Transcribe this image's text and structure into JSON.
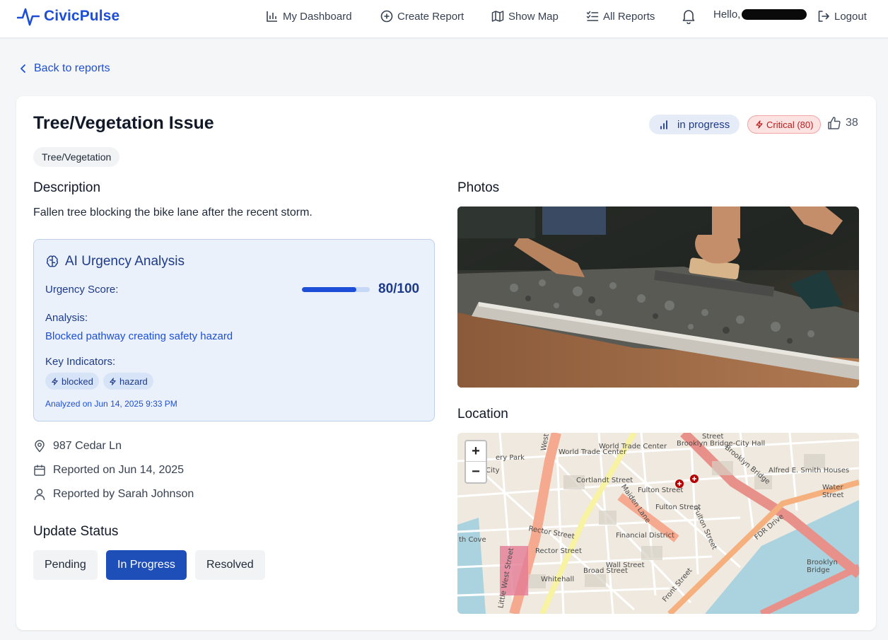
{
  "navbar": {
    "brand": "CivicPulse",
    "items": [
      {
        "label": "My Dashboard",
        "icon": "bar-chart-icon"
      },
      {
        "label": "Create Report",
        "icon": "plus-circle-icon"
      },
      {
        "label": "Show Map",
        "icon": "map-icon"
      },
      {
        "label": "All Reports",
        "icon": "list-check-icon"
      }
    ],
    "greeting": "Hello,",
    "logout": "Logout"
  },
  "back_link": "Back to reports",
  "report": {
    "title": "Tree/Vegetation Issue",
    "category": "Tree/Vegetation",
    "status": "in progress",
    "severity": "Critical (80)",
    "likes": "38",
    "description_heading": "Description",
    "description": "Fallen tree blocking the bike lane after the recent storm.",
    "photos_heading": "Photos",
    "location_heading": "Location",
    "address": "987 Cedar Ln",
    "reported_on": "Reported on Jun 14, 2025",
    "reported_by": "Reported by Sarah Johnson"
  },
  "ai_analysis": {
    "heading": "AI Urgency Analysis",
    "score_label": "Urgency Score:",
    "score": "80/100",
    "score_fraction": 0.8,
    "analysis_label": "Analysis:",
    "analysis_text": "Blocked pathway creating safety hazard",
    "indicators_label": "Key Indicators:",
    "indicators": [
      "blocked",
      "hazard"
    ],
    "analyzed_on": "Analyzed on Jun 14, 2025 9:33 PM"
  },
  "update_status": {
    "heading": "Update Status",
    "options": [
      "Pending",
      "In Progress",
      "Resolved"
    ],
    "selected": "In Progress"
  },
  "map": {
    "zoom_in": "+",
    "zoom_out": "−",
    "labels": [
      "World Trade Center",
      "World Trade Center",
      "Brooklyn Bridge-City Hall",
      "Brooklyn Bridge",
      "Cortlandt Street",
      "Fulton Street",
      "Fulton Street",
      "Maiden Lane",
      "Financial District",
      "Rector Street",
      "Wall Street",
      "Broad Street",
      "Whitehall",
      "FDR Drive",
      "Alfred E. Smith Houses",
      "Brooklyn Bridge",
      "Rector Street",
      "Water Street",
      "Front Street",
      "ery Park",
      "City",
      "th Cove",
      "Little West Street",
      "Fulton Street",
      "Street",
      "West"
    ]
  },
  "colors": {
    "brand": "#1d4ed8",
    "primary_button": "#1e4fb8",
    "critical": "#b91c1c",
    "ai_panel_bg": "#eaf1fb"
  }
}
